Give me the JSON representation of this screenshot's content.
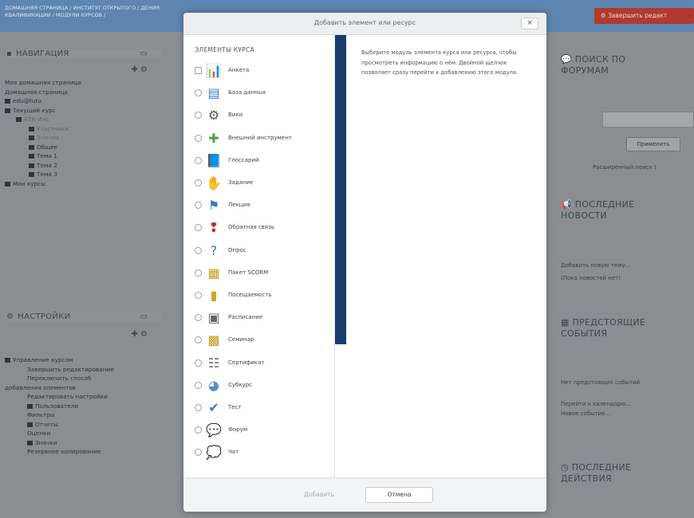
{
  "background": {
    "breadcrumb": "ДОМАШНЯЯ СТРАНИЦА / ИНСТИТУТ ОТКРЫТОГО / ДЕНИЯ КВАЛИФИКАЦИИ / МОДУЛИ КУРСОВ /",
    "edit_button": "Завершить редакт",
    "navigation": {
      "title": "НАВИГАЦИЯ",
      "items": [
        "Моя домашняя страница",
        "Домашняя страница",
        "edu@tutu",
        "Текущий курс",
        "АТК-Инс.",
        "Участники",
        "Значки",
        "Общее",
        "Тема 1",
        "Тема 2",
        "Тема 3",
        "Мои курсы"
      ]
    },
    "settings": {
      "title": "НАСТРОЙКИ",
      "items": [
        "Управление курсом",
        "Завершить редактирование",
        "Переключить способ",
        "добавления элементов",
        "Редактировать настройки",
        "Пользователи",
        "Фильтры",
        "Отчеты",
        "Оценки",
        "Значки",
        "Резервное копирование"
      ]
    },
    "search_forums": {
      "title_line1": "ПОИСК ПО",
      "title_line2": "ФОРУМАМ",
      "button": "Применить",
      "advanced_link": "Расширенный поиск ("
    },
    "news": {
      "title_line1": "ПОСЛЕДНИЕ",
      "title_line2": "НОВОСТИ",
      "add_topic": "Добавить новую тему...",
      "empty": "(Пока новостей нет)"
    },
    "events": {
      "title_line1": "ПРЕДСТОЯЩИЕ",
      "title_line2": "СОБЫТИЯ",
      "empty": "Нет предстоящих событий",
      "calendar_link": "Перейти к календарю...",
      "new_event": "Новое событие..."
    },
    "activity": {
      "title_line1": "ПОСЛЕДНИЕ",
      "title_line2": "ДЕЙСТВИЯ"
    }
  },
  "modal": {
    "title": "Добавить элемент или ресурс",
    "close": "×",
    "section_label": "ЭЛЕМЕНТЫ КУРСА",
    "options": [
      {
        "label": "Анкета",
        "icon": "chart-icon",
        "glyph": "📊"
      },
      {
        "label": "База данных",
        "icon": "database-icon",
        "glyph": "▤"
      },
      {
        "label": "Вики",
        "icon": "wiki-icon",
        "glyph": "⚙"
      },
      {
        "label": "Внешний инструмент",
        "icon": "puzzle-icon",
        "glyph": "✚"
      },
      {
        "label": "Глоссарий",
        "icon": "glossary-icon",
        "glyph": "📘"
      },
      {
        "label": "Задание",
        "icon": "assignment-icon",
        "glyph": "✋"
      },
      {
        "label": "Лекция",
        "icon": "lesson-icon",
        "glyph": "⚑"
      },
      {
        "label": "Обратная связь",
        "icon": "feedback-icon",
        "glyph": "❢"
      },
      {
        "label": "Опрос",
        "icon": "question-icon",
        "glyph": "?"
      },
      {
        "label": "Пакет SCORM",
        "icon": "scorm-icon",
        "glyph": "▦"
      },
      {
        "label": "Посещаемость",
        "icon": "attendance-icon",
        "glyph": "▮"
      },
      {
        "label": "Расписание",
        "icon": "schedule-icon",
        "glyph": "▣"
      },
      {
        "label": "Семинар",
        "icon": "workshop-icon",
        "glyph": "▩"
      },
      {
        "label": "Сертификат",
        "icon": "certificate-icon",
        "glyph": "☷"
      },
      {
        "label": "Субкурс",
        "icon": "subcourse-icon",
        "glyph": "◕"
      },
      {
        "label": "Тест",
        "icon": "quiz-icon",
        "glyph": "✔"
      },
      {
        "label": "Форум",
        "icon": "forum-icon",
        "glyph": "💬"
      },
      {
        "label": "Чат",
        "icon": "chat-icon",
        "glyph": "💭"
      }
    ],
    "description": "Выберите модуль элемента курса или ресурса, чтобы просмотреть информацию о нём. Двойной щелчок позволяет сразу перейти к добавлению этого модуля.",
    "add_button": "Добавить",
    "cancel_button": "Отмена",
    "colors": {
      "accent": "#1a3a6e"
    }
  }
}
